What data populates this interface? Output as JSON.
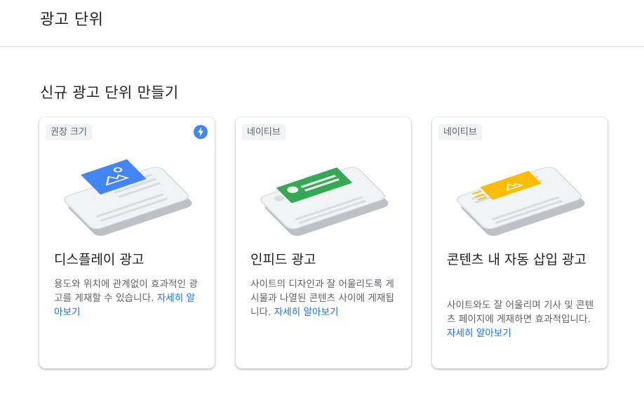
{
  "header": {
    "title": "광고 단위"
  },
  "section": {
    "title": "신규 광고 단위 만들기"
  },
  "colors": {
    "blue": "#4285f4",
    "green": "#34a853",
    "yellow": "#fbbc04",
    "link": "#1a73e8"
  },
  "cards": [
    {
      "chip": "권장 크기",
      "badge_icon": "lightning-bolt-icon",
      "title": "디스플레이 광고",
      "desc": "용도와 위치에 관계없이 효과적인 광고를 게재할 수 있습니다.",
      "link": "자세히 알아보기"
    },
    {
      "chip": "네이티브",
      "title": "인피드 광고",
      "desc": "사이트의 디자인과 잘 어울리도록 게시물과 나열된 콘텐츠 사이에 게재됩니다.",
      "link": "자세히 알아보기"
    },
    {
      "chip": "네이티브",
      "title": "콘텐츠 내 자동 삽입 광고",
      "desc": "사이트와도 잘 어울리며 기사 및 콘텐츠 페이지에 게재하면 효과적입니다.",
      "link": "자세히 알아보기"
    }
  ]
}
